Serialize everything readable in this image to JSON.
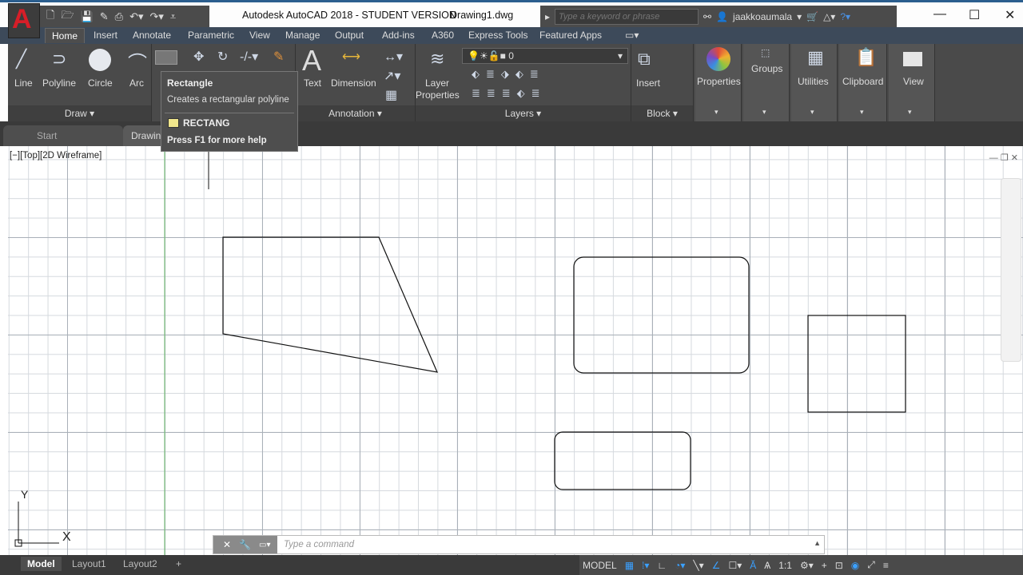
{
  "titlebar": {
    "app_title": "Autodesk AutoCAD 2018 - STUDENT VERSION",
    "document": "Drawing1.dwg",
    "search_placeholder": "Type a keyword or phrase",
    "user": "jaakkoaumala",
    "app_letter": "A"
  },
  "ribbon_tabs": [
    "Home",
    "Insert",
    "Annotate",
    "Parametric",
    "View",
    "Manage",
    "Output",
    "Add-ins",
    "A360",
    "Express Tools",
    "Featured Apps"
  ],
  "draw_panel": {
    "title": "Draw",
    "tools": [
      "Line",
      "Polyline",
      "Circle",
      "Arc"
    ]
  },
  "annotation_panel": {
    "title": "Annotation",
    "tools": [
      "Text",
      "Dimension"
    ]
  },
  "layers_panel": {
    "title": "Layers",
    "tool": "Layer Properties",
    "current_layer": "0"
  },
  "block_panel": {
    "title": "Block",
    "tool": "Insert"
  },
  "other_panels": [
    "Properties",
    "Groups",
    "Utilities",
    "Clipboard",
    "View"
  ],
  "tooltip": {
    "title": "Rectangle",
    "description": "Creates a rectangular polyline",
    "command": "RECTANG",
    "help": "Press F1 for more help"
  },
  "file_tabs": [
    "Start",
    "Drawing1"
  ],
  "viewport_label": "[−][Top][2D Wireframe]",
  "ucs": {
    "x": "X",
    "y": "Y"
  },
  "command_line": {
    "placeholder": "Type a command"
  },
  "layout_tabs": [
    "Model",
    "Layout1",
    "Layout2",
    "+"
  ],
  "status": {
    "mode": "MODEL",
    "scale": "1:1"
  }
}
